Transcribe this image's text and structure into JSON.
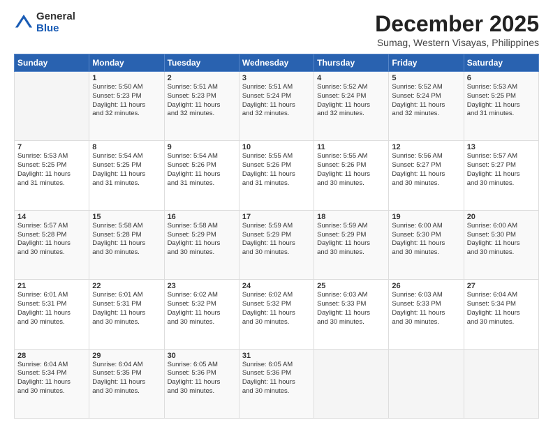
{
  "logo": {
    "general": "General",
    "blue": "Blue"
  },
  "title": "December 2025",
  "subtitle": "Sumag, Western Visayas, Philippines",
  "headers": [
    "Sunday",
    "Monday",
    "Tuesday",
    "Wednesday",
    "Thursday",
    "Friday",
    "Saturday"
  ],
  "weeks": [
    [
      {
        "day": "",
        "info": ""
      },
      {
        "day": "1",
        "info": "Sunrise: 5:50 AM\nSunset: 5:23 PM\nDaylight: 11 hours\nand 32 minutes."
      },
      {
        "day": "2",
        "info": "Sunrise: 5:51 AM\nSunset: 5:23 PM\nDaylight: 11 hours\nand 32 minutes."
      },
      {
        "day": "3",
        "info": "Sunrise: 5:51 AM\nSunset: 5:24 PM\nDaylight: 11 hours\nand 32 minutes."
      },
      {
        "day": "4",
        "info": "Sunrise: 5:52 AM\nSunset: 5:24 PM\nDaylight: 11 hours\nand 32 minutes."
      },
      {
        "day": "5",
        "info": "Sunrise: 5:52 AM\nSunset: 5:24 PM\nDaylight: 11 hours\nand 32 minutes."
      },
      {
        "day": "6",
        "info": "Sunrise: 5:53 AM\nSunset: 5:25 PM\nDaylight: 11 hours\nand 31 minutes."
      }
    ],
    [
      {
        "day": "7",
        "info": "Sunrise: 5:53 AM\nSunset: 5:25 PM\nDaylight: 11 hours\nand 31 minutes."
      },
      {
        "day": "8",
        "info": "Sunrise: 5:54 AM\nSunset: 5:25 PM\nDaylight: 11 hours\nand 31 minutes."
      },
      {
        "day": "9",
        "info": "Sunrise: 5:54 AM\nSunset: 5:26 PM\nDaylight: 11 hours\nand 31 minutes."
      },
      {
        "day": "10",
        "info": "Sunrise: 5:55 AM\nSunset: 5:26 PM\nDaylight: 11 hours\nand 31 minutes."
      },
      {
        "day": "11",
        "info": "Sunrise: 5:55 AM\nSunset: 5:26 PM\nDaylight: 11 hours\nand 30 minutes."
      },
      {
        "day": "12",
        "info": "Sunrise: 5:56 AM\nSunset: 5:27 PM\nDaylight: 11 hours\nand 30 minutes."
      },
      {
        "day": "13",
        "info": "Sunrise: 5:57 AM\nSunset: 5:27 PM\nDaylight: 11 hours\nand 30 minutes."
      }
    ],
    [
      {
        "day": "14",
        "info": "Sunrise: 5:57 AM\nSunset: 5:28 PM\nDaylight: 11 hours\nand 30 minutes."
      },
      {
        "day": "15",
        "info": "Sunrise: 5:58 AM\nSunset: 5:28 PM\nDaylight: 11 hours\nand 30 minutes."
      },
      {
        "day": "16",
        "info": "Sunrise: 5:58 AM\nSunset: 5:29 PM\nDaylight: 11 hours\nand 30 minutes."
      },
      {
        "day": "17",
        "info": "Sunrise: 5:59 AM\nSunset: 5:29 PM\nDaylight: 11 hours\nand 30 minutes."
      },
      {
        "day": "18",
        "info": "Sunrise: 5:59 AM\nSunset: 5:29 PM\nDaylight: 11 hours\nand 30 minutes."
      },
      {
        "day": "19",
        "info": "Sunrise: 6:00 AM\nSunset: 5:30 PM\nDaylight: 11 hours\nand 30 minutes."
      },
      {
        "day": "20",
        "info": "Sunrise: 6:00 AM\nSunset: 5:30 PM\nDaylight: 11 hours\nand 30 minutes."
      }
    ],
    [
      {
        "day": "21",
        "info": "Sunrise: 6:01 AM\nSunset: 5:31 PM\nDaylight: 11 hours\nand 30 minutes."
      },
      {
        "day": "22",
        "info": "Sunrise: 6:01 AM\nSunset: 5:31 PM\nDaylight: 11 hours\nand 30 minutes."
      },
      {
        "day": "23",
        "info": "Sunrise: 6:02 AM\nSunset: 5:32 PM\nDaylight: 11 hours\nand 30 minutes."
      },
      {
        "day": "24",
        "info": "Sunrise: 6:02 AM\nSunset: 5:32 PM\nDaylight: 11 hours\nand 30 minutes."
      },
      {
        "day": "25",
        "info": "Sunrise: 6:03 AM\nSunset: 5:33 PM\nDaylight: 11 hours\nand 30 minutes."
      },
      {
        "day": "26",
        "info": "Sunrise: 6:03 AM\nSunset: 5:33 PM\nDaylight: 11 hours\nand 30 minutes."
      },
      {
        "day": "27",
        "info": "Sunrise: 6:04 AM\nSunset: 5:34 PM\nDaylight: 11 hours\nand 30 minutes."
      }
    ],
    [
      {
        "day": "28",
        "info": "Sunrise: 6:04 AM\nSunset: 5:34 PM\nDaylight: 11 hours\nand 30 minutes."
      },
      {
        "day": "29",
        "info": "Sunrise: 6:04 AM\nSunset: 5:35 PM\nDaylight: 11 hours\nand 30 minutes."
      },
      {
        "day": "30",
        "info": "Sunrise: 6:05 AM\nSunset: 5:36 PM\nDaylight: 11 hours\nand 30 minutes."
      },
      {
        "day": "31",
        "info": "Sunrise: 6:05 AM\nSunset: 5:36 PM\nDaylight: 11 hours\nand 30 minutes."
      },
      {
        "day": "",
        "info": ""
      },
      {
        "day": "",
        "info": ""
      },
      {
        "day": "",
        "info": ""
      }
    ]
  ]
}
